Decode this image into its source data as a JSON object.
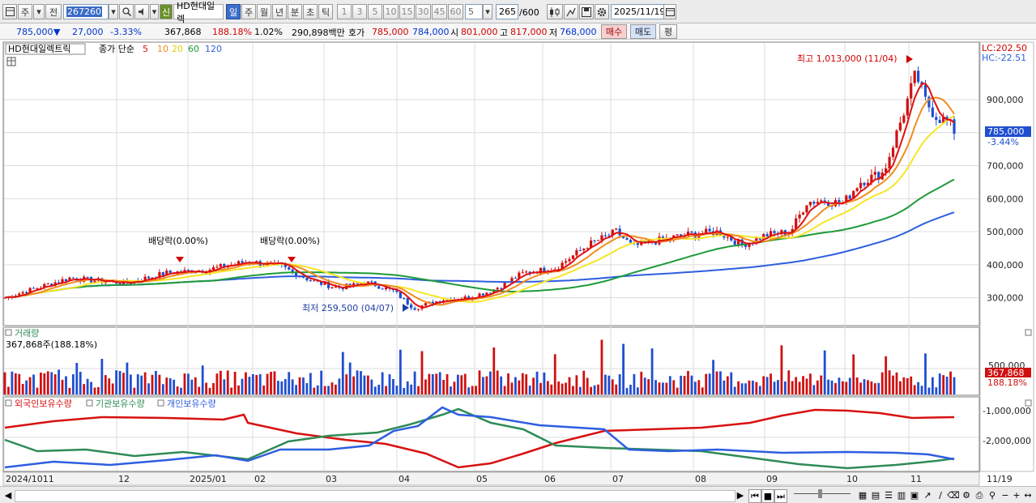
{
  "toolbar": {
    "btn_ju": "주",
    "btn_jeon": "전",
    "code": "267260",
    "sin": "신",
    "stock_name": "HD현대일렉",
    "periods": [
      "일",
      "주",
      "월",
      "년",
      "분",
      "초",
      "틱"
    ],
    "minutes": [
      "1",
      "3",
      "5",
      "10",
      "15",
      "30",
      "45",
      "60"
    ],
    "interval_value": "5",
    "count": "265",
    "count_max": "/600",
    "date": "2025/11/19"
  },
  "info": {
    "price": "785,000",
    "arrow": "▼",
    "change": "27,000",
    "change_pct": "-3.33%",
    "volume": "367,868",
    "volume_ratio": "188.18%",
    "turnover": "1.02%",
    "amount": "290,898백만",
    "hoga_label": "호가",
    "ask": "785,000",
    "bid": "784,000",
    "open_label": "시",
    "open": "801,000",
    "high_label": "고",
    "high": "817,000",
    "low_label": "저",
    "low": "768,000",
    "buy": "매수",
    "sell": "매도",
    "eval": "평"
  },
  "price_panel": {
    "name": "HD현대일렉트릭",
    "ma_label": "종가 단순",
    "ma_periods": [
      "5",
      "10",
      "20",
      "60",
      "120"
    ],
    "max_label": "최고 1,013,000 (11/04)",
    "min_label": "최저 259,500 (04/07)",
    "dividend1": "배당락(0.00%)",
    "dividend2": "배당락(0.00%)",
    "lc": "LC:202.50",
    "hc": "HC:-22.51",
    "current_tag": "785,000",
    "current_pct": "-3.44%",
    "y_ticks": [
      "900,000",
      "800,000",
      "700,000",
      "600,000",
      "500,000",
      "400,000",
      "300,000"
    ]
  },
  "volume_panel": {
    "name": "거래량",
    "value": "367,868주(188.18%)",
    "y_tick": "500,000",
    "tag": "367,868",
    "tag_pct": "188.18%"
  },
  "holding_panel": {
    "series": [
      "외국인보유수량",
      "기관보유수량",
      "개인보유수량"
    ],
    "y_ticks": [
      "-1,000,000",
      "-2,000,000"
    ]
  },
  "x_axis": [
    "2024/10",
    "11",
    "12",
    "2025/01",
    "02",
    "03",
    "04",
    "05",
    "06",
    "07",
    "08",
    "09",
    "10",
    "11"
  ],
  "x_last": "11/19",
  "colors": {
    "up": "#d01010",
    "down": "#1f4fd0",
    "ma5": "#e01010",
    "ma10": "#f08c20",
    "ma20": "#f5e626",
    "ma60": "#1e9a3a",
    "ma120": "#2e5ee0",
    "foreign": "#d81010",
    "institution": "#2e8b57",
    "individual": "#2e5ee0"
  },
  "icons": [
    "layout-icon",
    "search-icon",
    "speaker-icon",
    "candle-chart-icon",
    "draw-icon",
    "save-icon",
    "gear-icon",
    "calendar-icon",
    "zoom-out-icon",
    "zoom-in-icon"
  ]
}
